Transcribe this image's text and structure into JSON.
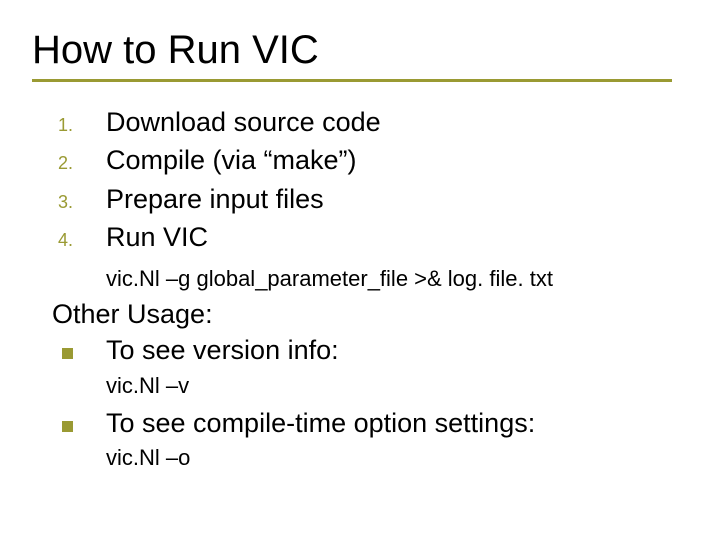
{
  "title": "How to Run VIC",
  "numbered": [
    {
      "n": "1.",
      "text": "Download source code"
    },
    {
      "n": "2.",
      "text": "Compile (via “make”)"
    },
    {
      "n": "3.",
      "text": "Prepare input files"
    },
    {
      "n": "4.",
      "text": "Run VIC"
    }
  ],
  "command1": "vic.Nl –g global_parameter_file >& log. file. txt",
  "other_usage_label": "Other Usage:",
  "bullets": [
    {
      "text": "To see version info:",
      "sub": "vic.Nl –v"
    },
    {
      "text": "To see compile-time option settings:",
      "sub": "vic.Nl –o"
    }
  ]
}
